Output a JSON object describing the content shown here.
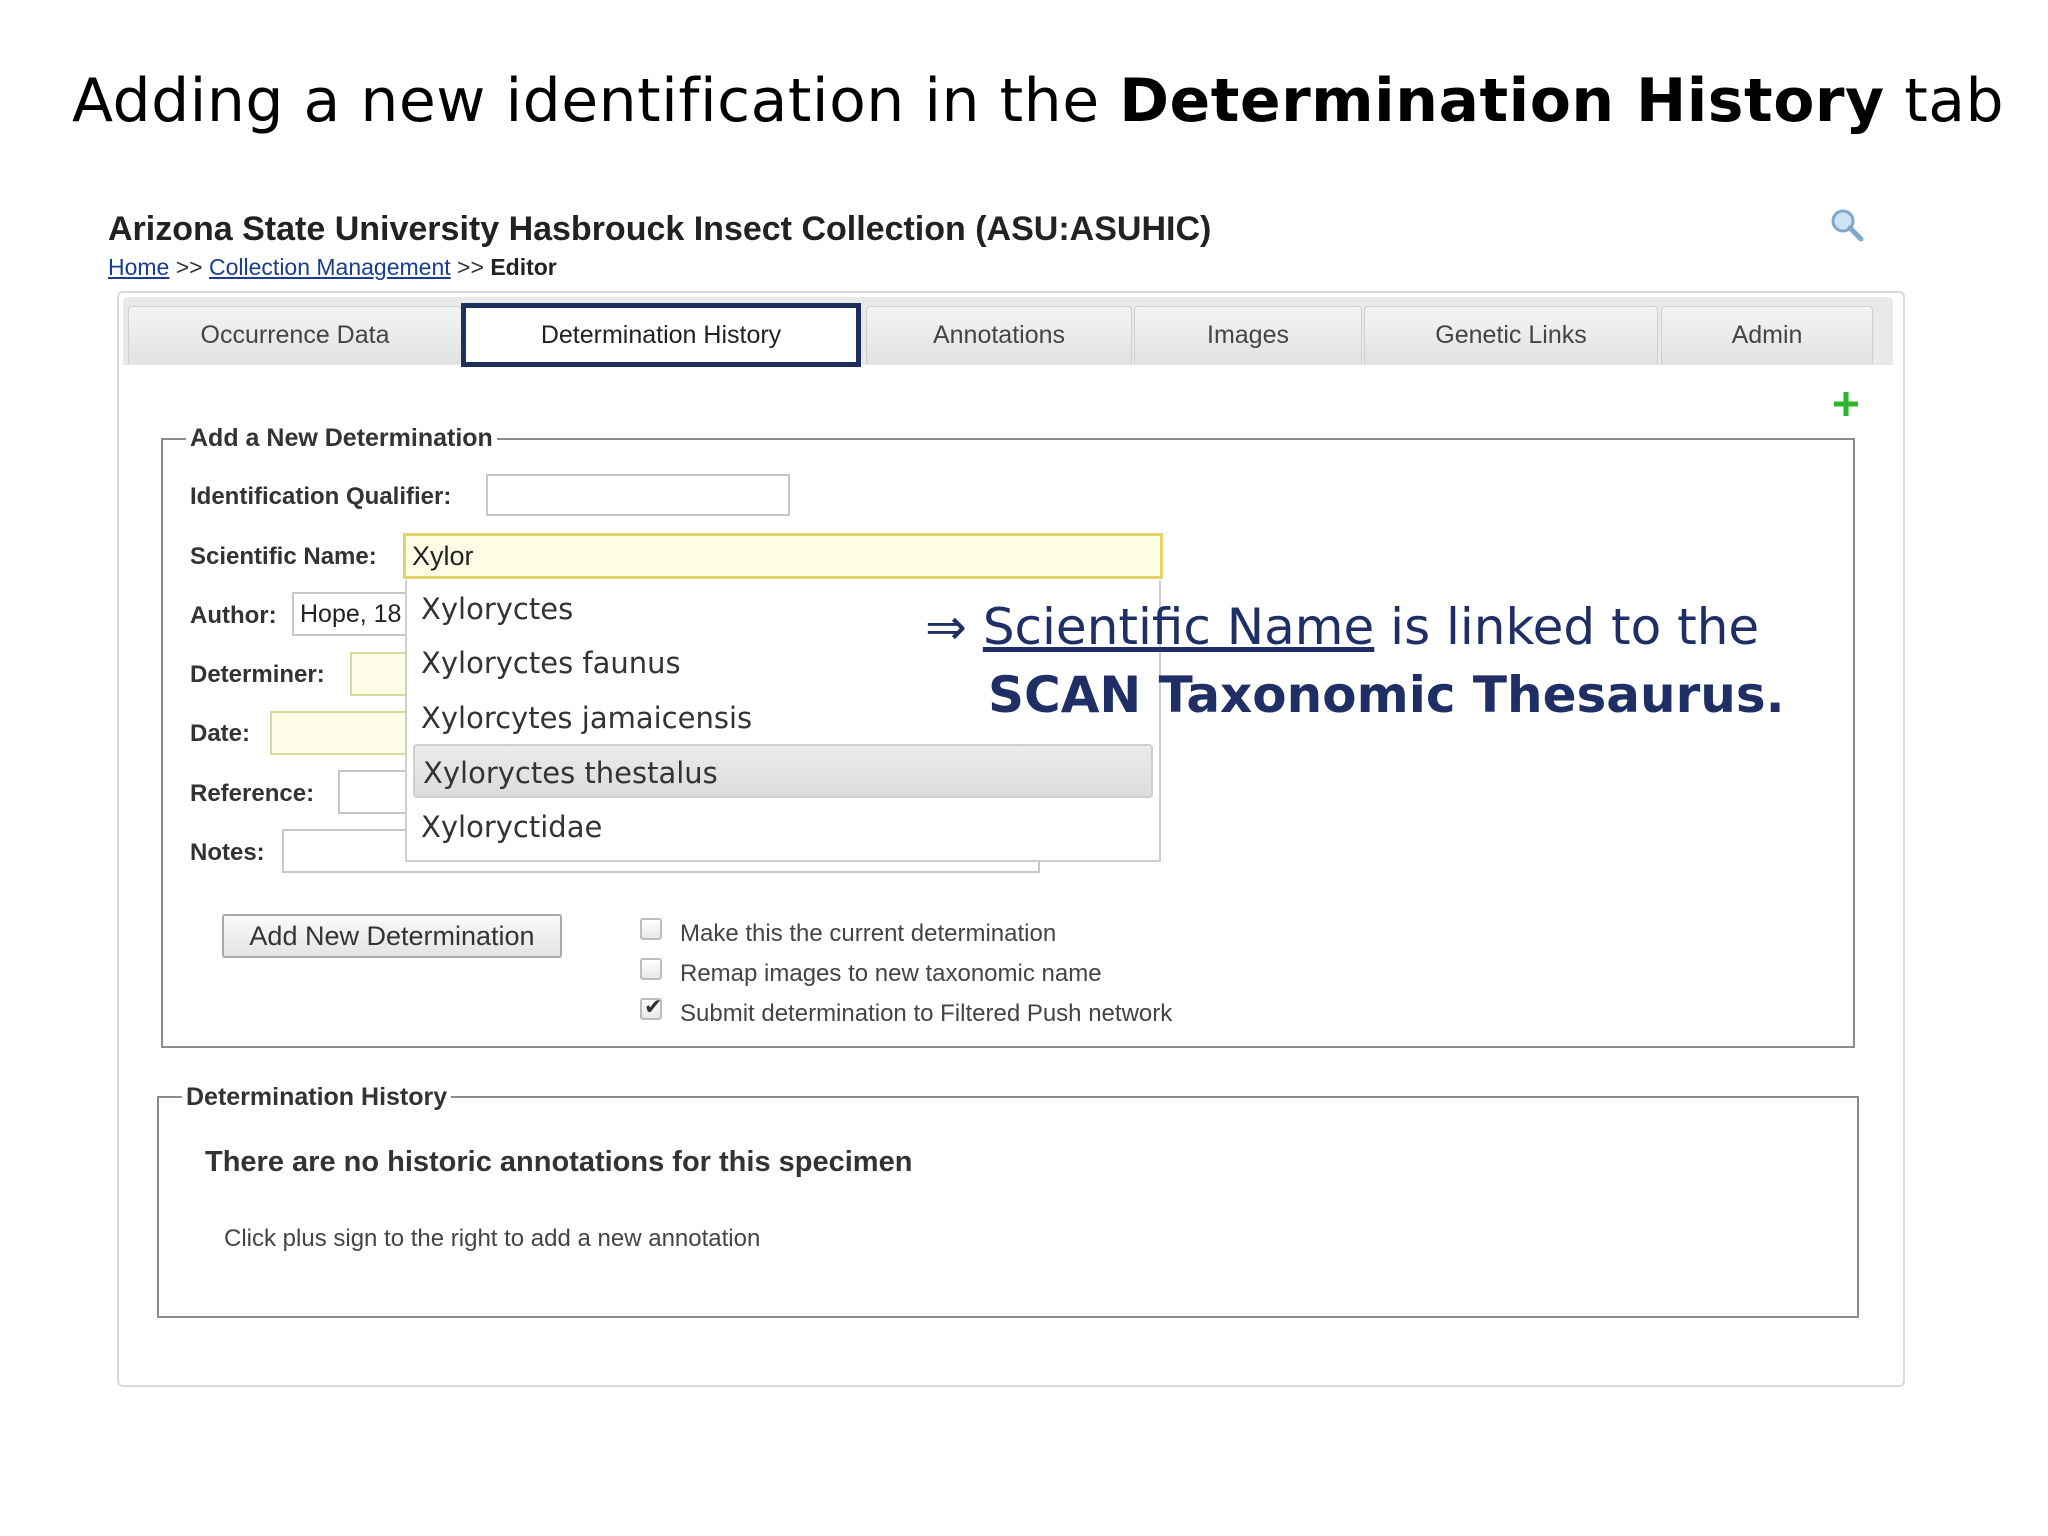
{
  "slide": {
    "title_prefix": "Adding a new identification in the ",
    "title_bold": "Determination History",
    "title_suffix": " tab"
  },
  "header": {
    "title": "Arizona State University Hasbrouck Insect Collection (ASU:ASUHIC)",
    "breadcrumb": {
      "home": "Home",
      "sep": ">>",
      "collection_management": "Collection Management",
      "current": "Editor"
    }
  },
  "tabs": [
    {
      "label": "Occurrence Data",
      "active": false
    },
    {
      "label": "Determination History",
      "active": true
    },
    {
      "label": "Annotations",
      "active": false
    },
    {
      "label": "Images",
      "active": false
    },
    {
      "label": "Genetic Links",
      "active": false
    },
    {
      "label": "Admin",
      "active": false
    }
  ],
  "add_determination": {
    "legend": "Add a New Determination",
    "fields": {
      "identification_qualifier": {
        "label": "Identification Qualifier:",
        "value": ""
      },
      "scientific_name": {
        "label": "Scientific Name:",
        "value": "Xylor"
      },
      "author": {
        "label": "Author:",
        "value": "Hope, 18"
      },
      "determiner": {
        "label": "Determiner:",
        "value": ""
      },
      "date": {
        "label": "Date:",
        "value": ""
      },
      "reference": {
        "label": "Reference:",
        "value": ""
      },
      "notes": {
        "label": "Notes:",
        "value": ""
      }
    },
    "autocomplete": {
      "options": [
        "Xyloryctes",
        "Xyloryctes faunus",
        "Xylorcytes jamaicensis",
        "Xyloryctes thestalus",
        "Xyloryctidae"
      ],
      "highlighted_index": 3
    },
    "button_label": "Add New Determination",
    "checkboxes": [
      {
        "label": "Make this the current determination",
        "checked": false
      },
      {
        "label": "Remap images to new taxonomic name",
        "checked": false
      },
      {
        "label": "Submit determination to Filtered Push network",
        "checked": true
      }
    ]
  },
  "annotation": {
    "arrow": "⇒",
    "link_text": "Scientific Name",
    "rest_line1": " is linked to the",
    "line2": "SCAN Taxonomic Thesaurus."
  },
  "history": {
    "legend": "Determination History",
    "heading": "There are no historic annotations for this specimen",
    "text": "Click plus sign to the right to add a new annotation"
  },
  "colors": {
    "active_tab_border": "#1f2f5c",
    "annotation_text": "#1f2f66",
    "plus_icon": "#2db52d",
    "link": "#1a3d8f"
  }
}
